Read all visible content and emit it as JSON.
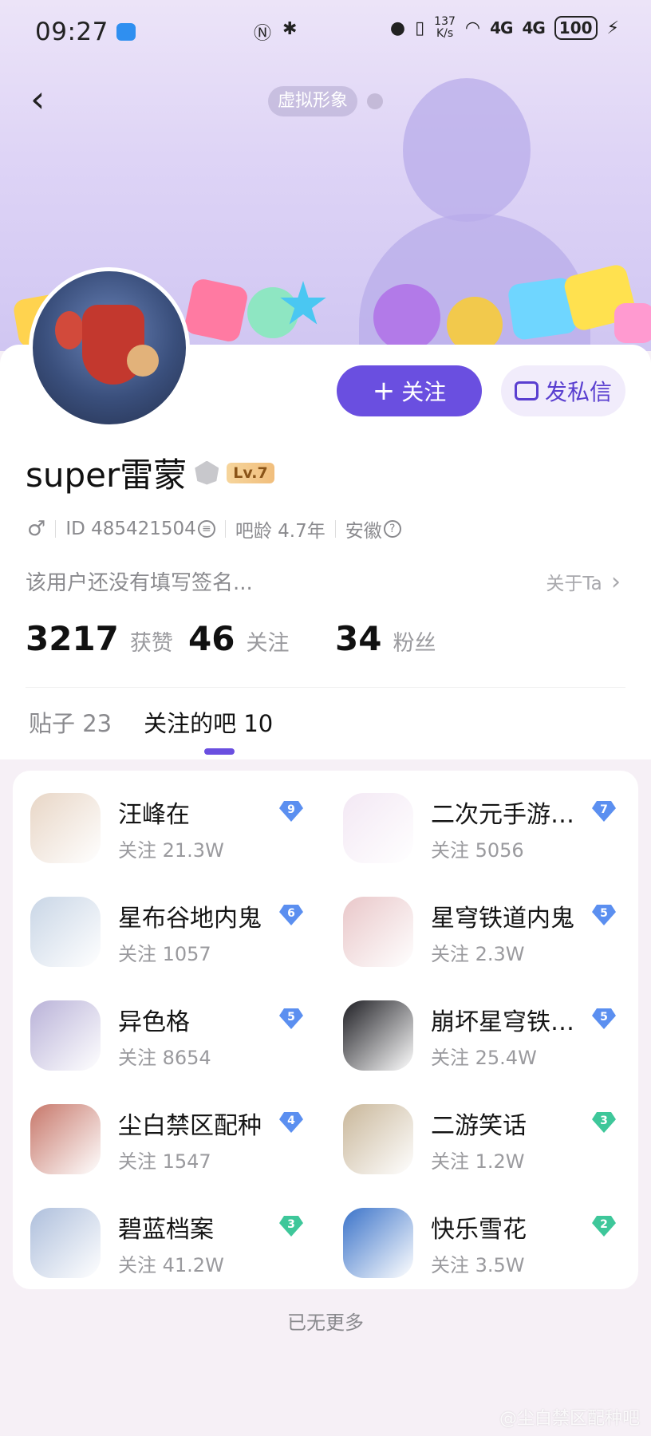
{
  "status_bar": {
    "time": "09:27",
    "network_speed_value": "137",
    "network_speed_unit": "K/s",
    "signal_1": "4G",
    "signal_2": "4G",
    "battery": "100"
  },
  "header": {
    "avatar_chip": "虚拟形象"
  },
  "profile": {
    "username": "super雷蒙",
    "level": "Lv.7",
    "gender_icon": "♂",
    "id_text": "ID 485421504",
    "bar_age": "吧龄 4.7年",
    "location": "安徽",
    "signature": "该用户还没有填写签名...",
    "about_link": "关于Ta",
    "follow_label": "关注",
    "message_label": "发私信"
  },
  "stats": {
    "likes_value": "3217",
    "likes_label": "获赞",
    "following_value": "46",
    "following_label": "关注",
    "fans_value": "34",
    "fans_label": "粉丝"
  },
  "tabs": {
    "posts": "贴子 23",
    "followed_bars": "关注的吧 10"
  },
  "bars": [
    {
      "name": "汪峰在",
      "followers": "关注 21.3W",
      "level": "9",
      "color": "#5b8ff0",
      "thumb": "#e8d6c6"
    },
    {
      "name": "二次元手游…",
      "followers": "关注 5056",
      "level": "7",
      "color": "#5b8ff0",
      "thumb": "#f3e8f4"
    },
    {
      "name": "星布谷地内鬼",
      "followers": "关注 1057",
      "level": "6",
      "color": "#5b8ff0",
      "thumb": "#c9d6e6"
    },
    {
      "name": "星穹铁道内鬼",
      "followers": "关注 2.3W",
      "level": "5",
      "color": "#5b8ff0",
      "thumb": "#e9c7c9"
    },
    {
      "name": "异色格",
      "followers": "关注 8654",
      "level": "5",
      "color": "#5b8ff0",
      "thumb": "#b9b2d8"
    },
    {
      "name": "崩坏星穹铁…",
      "followers": "关注 25.4W",
      "level": "5",
      "color": "#5b8ff0",
      "thumb": "#1f1f24"
    },
    {
      "name": "尘白禁区配种",
      "followers": "关注 1547",
      "level": "4",
      "color": "#5b8ff0",
      "thumb": "#c7776a"
    },
    {
      "name": "二游笑话",
      "followers": "关注 1.2W",
      "level": "3",
      "color": "#3ec79a",
      "thumb": "#c9b79a"
    },
    {
      "name": "碧蓝档案",
      "followers": "关注 41.2W",
      "level": "3",
      "color": "#3ec79a",
      "thumb": "#aebfdc"
    },
    {
      "name": "快乐雪花",
      "followers": "关注 3.5W",
      "level": "2",
      "color": "#3ec79a",
      "thumb": "#3b73c9"
    }
  ],
  "footer": {
    "no_more": "已无更多",
    "watermark": "@尘白禁区配种吧"
  }
}
